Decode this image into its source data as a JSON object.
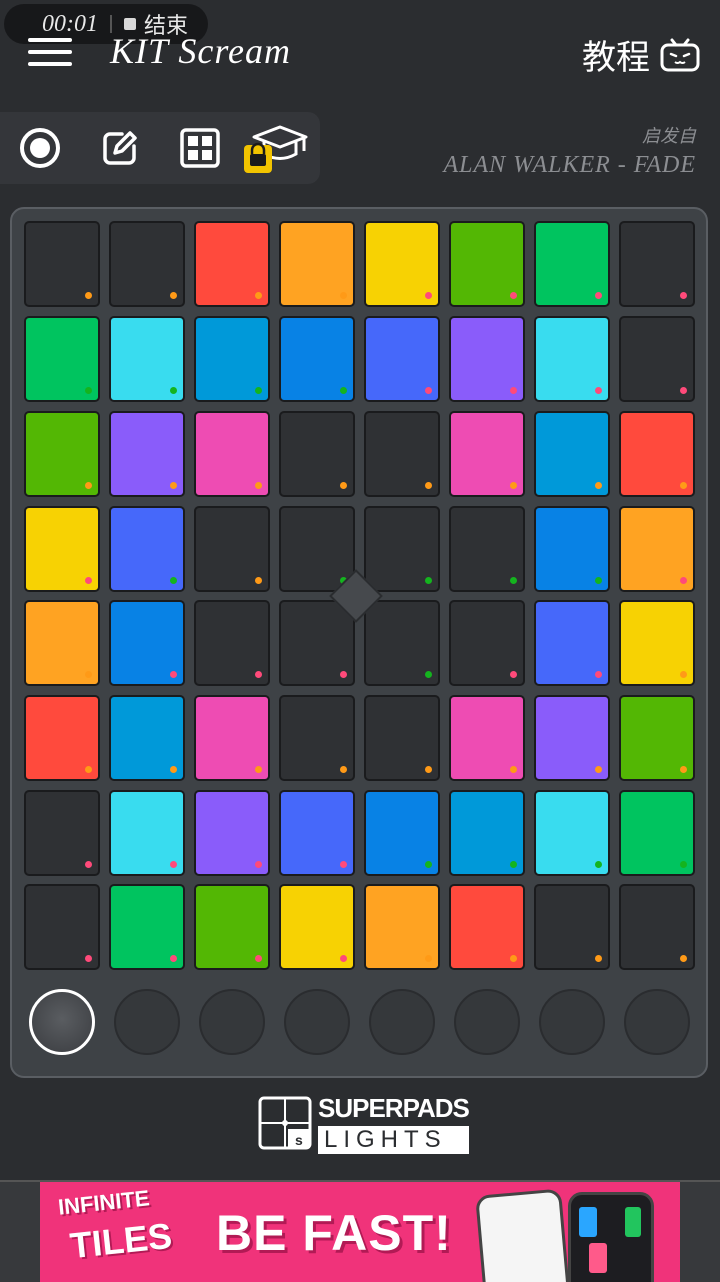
{
  "recording": {
    "time": "00:01",
    "stop_label": "结束"
  },
  "header": {
    "title": "KIT Scream",
    "tutorial_label": "教程"
  },
  "toolbar": {
    "icons": [
      "record-icon",
      "edit-icon",
      "grid-icon",
      "tutorial-cap-icon"
    ],
    "locked": true
  },
  "inspired": {
    "label": "启发自",
    "song": "ALAN WALKER - FADE"
  },
  "colors": {
    "K": "#2f3134",
    "R": "#ff4a3d",
    "O": "#ffa322",
    "Y": "#f7d203",
    "G": "#53b704",
    "E": "#00c45f",
    "C": "#39dcef",
    "S": "#0099d9",
    "B": "#0882e5",
    "I": "#4668fa",
    "V": "#8a5cfa",
    "P": "#ee4cb3",
    "dot_orange": "#ff9a17",
    "dot_pink": "#ff4a7a",
    "dot_green": "#14b41e"
  },
  "pads": [
    [
      "K",
      "K",
      "R",
      "O",
      "Y",
      "G",
      "E",
      "K"
    ],
    [
      "E",
      "C",
      "S",
      "B",
      "I",
      "V",
      "C",
      "K"
    ],
    [
      "G",
      "V",
      "P",
      "K",
      "K",
      "P",
      "S",
      "R"
    ],
    [
      "Y",
      "I",
      "K",
      "K",
      "K",
      "K",
      "B",
      "O"
    ],
    [
      "O",
      "B",
      "K",
      "K",
      "K",
      "K",
      "I",
      "Y"
    ],
    [
      "R",
      "S",
      "P",
      "K",
      "K",
      "P",
      "V",
      "G"
    ],
    [
      "K",
      "C",
      "V",
      "I",
      "B",
      "S",
      "C",
      "E"
    ],
    [
      "K",
      "E",
      "G",
      "Y",
      "O",
      "R",
      "K",
      "K"
    ]
  ],
  "pad_dots": [
    [
      "o",
      "o",
      "o",
      "o",
      "p",
      "p",
      "p",
      "p"
    ],
    [
      "g",
      "g",
      "g",
      "g",
      "p",
      "p",
      "p",
      "p"
    ],
    [
      "o",
      "o",
      "o",
      "o",
      "o",
      "o",
      "o",
      "o"
    ],
    [
      "p",
      "g",
      "o",
      "g",
      "g",
      "g",
      "g",
      "p"
    ],
    [
      "o",
      "p",
      "p",
      "p",
      "g",
      "p",
      "p",
      "o"
    ],
    [
      "o",
      "o",
      "o",
      "o",
      "o",
      "o",
      "o",
      "o"
    ],
    [
      "p",
      "p",
      "p",
      "p",
      "g",
      "g",
      "g",
      "g"
    ],
    [
      "p",
      "p",
      "p",
      "p",
      "o",
      "o",
      "o",
      "o"
    ]
  ],
  "round_buttons": {
    "count": 8,
    "active_index": 0
  },
  "logo": {
    "word1": "SUPERPADS",
    "word2": "LIGHTS"
  },
  "ad": {
    "line1": "INFINITE",
    "line2": "TILES",
    "headline": "BE FAST!"
  }
}
